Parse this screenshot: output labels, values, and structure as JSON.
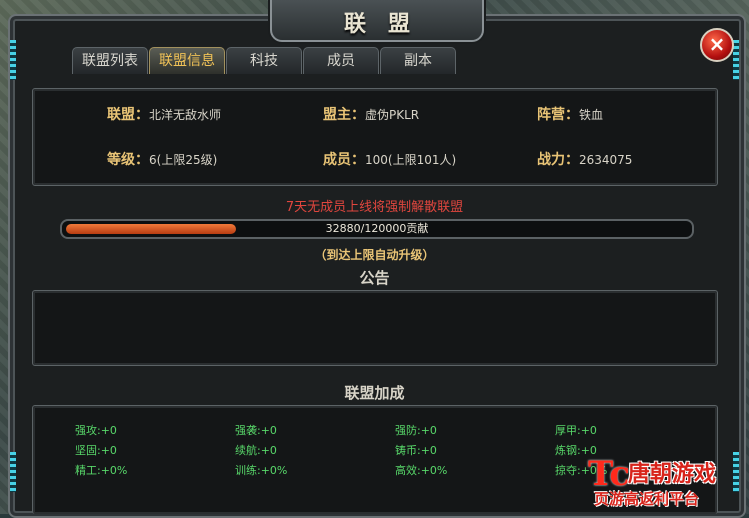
{
  "window": {
    "title": "联盟",
    "close_label": "×"
  },
  "tabs": [
    {
      "label": "联盟列表"
    },
    {
      "label": "联盟信息"
    },
    {
      "label": "科技"
    },
    {
      "label": "成员"
    },
    {
      "label": "副本"
    }
  ],
  "active_tab": "联盟信息",
  "info": {
    "alliance_label": "联盟：",
    "alliance_value": "北洋无敌水师",
    "leader_label": "盟主：",
    "leader_value": "虚伪PKLR",
    "camp_label": "阵营：",
    "camp_value": "铁血",
    "level_label": "等级：",
    "level_value": "6(上限25级)",
    "members_label": "成员：",
    "members_value": "100(上限101人)",
    "power_label": "战力：",
    "power_value": "2634075"
  },
  "warning": "7天无成员上线将强制解散联盟",
  "progress": {
    "text": "32880/120000贡献",
    "current": 32880,
    "max": 120000
  },
  "auto_upgrade_hint": "（到达上限自动升级）",
  "notice": {
    "heading": "公告",
    "content": ""
  },
  "bonus": {
    "heading": "联盟加成",
    "items": [
      "强攻:+0",
      "强袭:+0",
      "强防:+0",
      "厚甲:+0",
      "坚固:+0",
      "续航:+0",
      "铸币:+0",
      "炼钢:+0",
      "精工:+0%",
      "训练:+0%",
      "高效:+0%",
      "掠夺:+0%"
    ]
  },
  "watermark": {
    "logo": "Tc",
    "name": "唐朝游戏",
    "sub": "页游高返利平台"
  },
  "colors": {
    "accent": "#e9c476",
    "warning": "#e0463e",
    "bonus": "#58d86a",
    "progress": "#e2622a"
  }
}
